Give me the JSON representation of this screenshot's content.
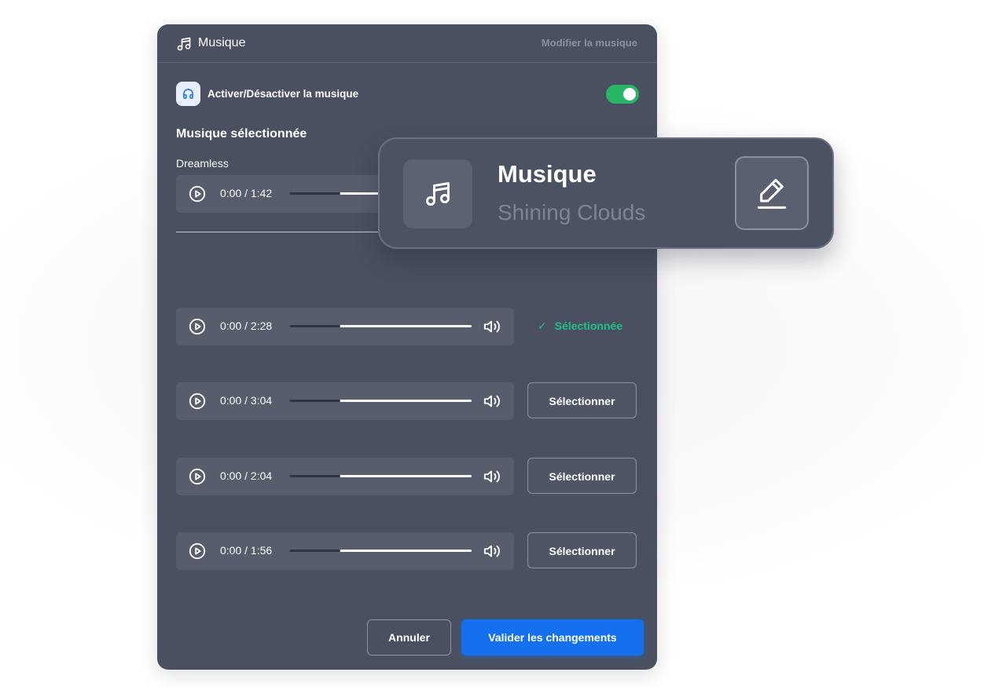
{
  "colors": {
    "panel_bg": "#4a5060",
    "toggle_on": "#29b567",
    "selected_green": "#1fc086",
    "primary_button": "#1570f0"
  },
  "header": {
    "title": "Musique",
    "icon": "music-note-icon",
    "edit_link": "Modifier la musique"
  },
  "toggle": {
    "icon": "headphones-icon",
    "label": "Activer/Désactiver la musique",
    "enabled": true
  },
  "section_title": "Musique sélectionnée",
  "selected_track": {
    "name": "Dreamless",
    "time": "0:00 / 1:42",
    "progress": 0.28
  },
  "tracks": [
    {
      "time": "0:00 / 2:28",
      "progress": 0.28,
      "status": "Sélectionnée"
    },
    {
      "time": "0:00 / 3:04",
      "progress": 0.28,
      "action": "Sélectionner"
    },
    {
      "time": "0:00 / 2:04",
      "progress": 0.28,
      "action": "Sélectionner"
    },
    {
      "time": "0:00 / 1:56",
      "progress": 0.28,
      "action": "Sélectionner"
    }
  ],
  "footer": {
    "cancel": "Annuler",
    "confirm": "Valider les changements"
  },
  "card": {
    "title": "Musique",
    "subtitle": "Shining Clouds",
    "icon": "music-note-icon",
    "edit_icon": "pencil-icon"
  }
}
